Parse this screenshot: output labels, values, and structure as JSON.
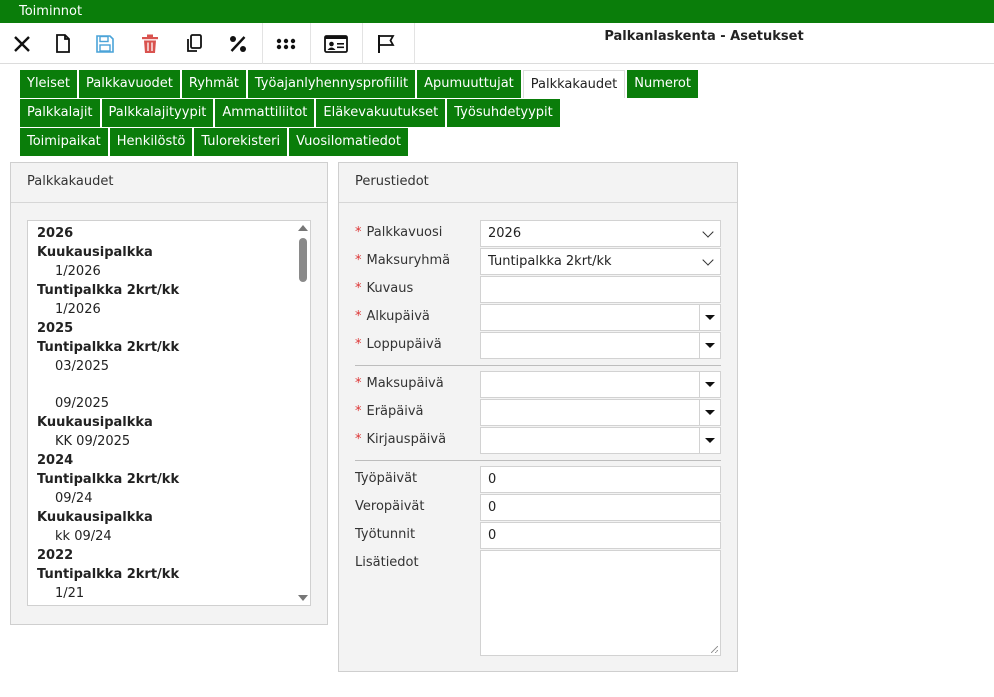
{
  "app": {
    "menu_title": "Toiminnot",
    "page_title": "Palkanlaskenta - Asetukset"
  },
  "toolbar": {
    "icons": [
      "close-icon",
      "new-document-icon",
      "save-icon",
      "delete-icon",
      "copy-icon",
      "percent-icon",
      "apps-grid-icon",
      "id-card-icon",
      "flag-icon"
    ]
  },
  "tabs": {
    "row1": [
      "Yleiset",
      "Palkkavuodet",
      "Ryhmät",
      "Työajanlyhennysprofiilit",
      "Apumuuttujat",
      "Palkkakaudet",
      "Numerot"
    ],
    "row2": [
      "Palkkalajit",
      "Palkkalajityypit",
      "Ammattiliitot",
      "Eläkevakuutukset",
      "Työsuhdetyypit"
    ],
    "row3": [
      "Toimipaikat",
      "Henkilöstö",
      "Tulorekisteri",
      "Vuosilomatiedot"
    ],
    "active": "Palkkakaudet"
  },
  "left_panel": {
    "title": "Palkkakaudet",
    "list": [
      {
        "type": "year",
        "text": "2026"
      },
      {
        "type": "group",
        "text": "Kuukausipalkka"
      },
      {
        "type": "item",
        "text": "1/2026"
      },
      {
        "type": "group",
        "text": "Tuntipalkka 2krt/kk"
      },
      {
        "type": "item",
        "text": "1/2026"
      },
      {
        "type": "year",
        "text": "2025"
      },
      {
        "type": "group",
        "text": "Tuntipalkka 2krt/kk"
      },
      {
        "type": "item",
        "text": "03/2025"
      },
      {
        "type": "item",
        "text": "09/2025"
      },
      {
        "type": "group",
        "text": "Kuukausipalkka"
      },
      {
        "type": "item",
        "text": "KK 09/2025"
      },
      {
        "type": "year",
        "text": "2024"
      },
      {
        "type": "group",
        "text": "Tuntipalkka 2krt/kk"
      },
      {
        "type": "item",
        "text": "09/24"
      },
      {
        "type": "group",
        "text": "Kuukausipalkka"
      },
      {
        "type": "item",
        "text": "kk 09/24"
      },
      {
        "type": "year",
        "text": "2022"
      },
      {
        "type": "group",
        "text": "Tuntipalkka 2krt/kk"
      },
      {
        "type": "item",
        "text": "1/21"
      }
    ]
  },
  "right_panel": {
    "title": "Perustiedot",
    "required_mark": "*",
    "fields": {
      "palkkavuosi": {
        "label": "Palkkavuosi",
        "value": "2026"
      },
      "maksuryhma": {
        "label": "Maksuryhmä",
        "value": "Tuntipalkka 2krt/kk"
      },
      "kuvaus": {
        "label": "Kuvaus",
        "value": ""
      },
      "alkupaiva": {
        "label": "Alkupäivä",
        "value": ""
      },
      "loppupaiva": {
        "label": "Loppupäivä",
        "value": ""
      },
      "maksupaiva": {
        "label": "Maksupäivä",
        "value": ""
      },
      "erapaiva": {
        "label": "Eräpäivä",
        "value": ""
      },
      "kirjauspaiva": {
        "label": "Kirjauspäivä",
        "value": ""
      },
      "tyopaivat": {
        "label": "Työpäivät",
        "value": "0"
      },
      "veropaivat": {
        "label": "Veropäivät",
        "value": "0"
      },
      "tyotunnit": {
        "label": "Työtunnit",
        "value": "0"
      },
      "lisatiedot": {
        "label": "Lisätiedot",
        "value": ""
      }
    }
  }
}
